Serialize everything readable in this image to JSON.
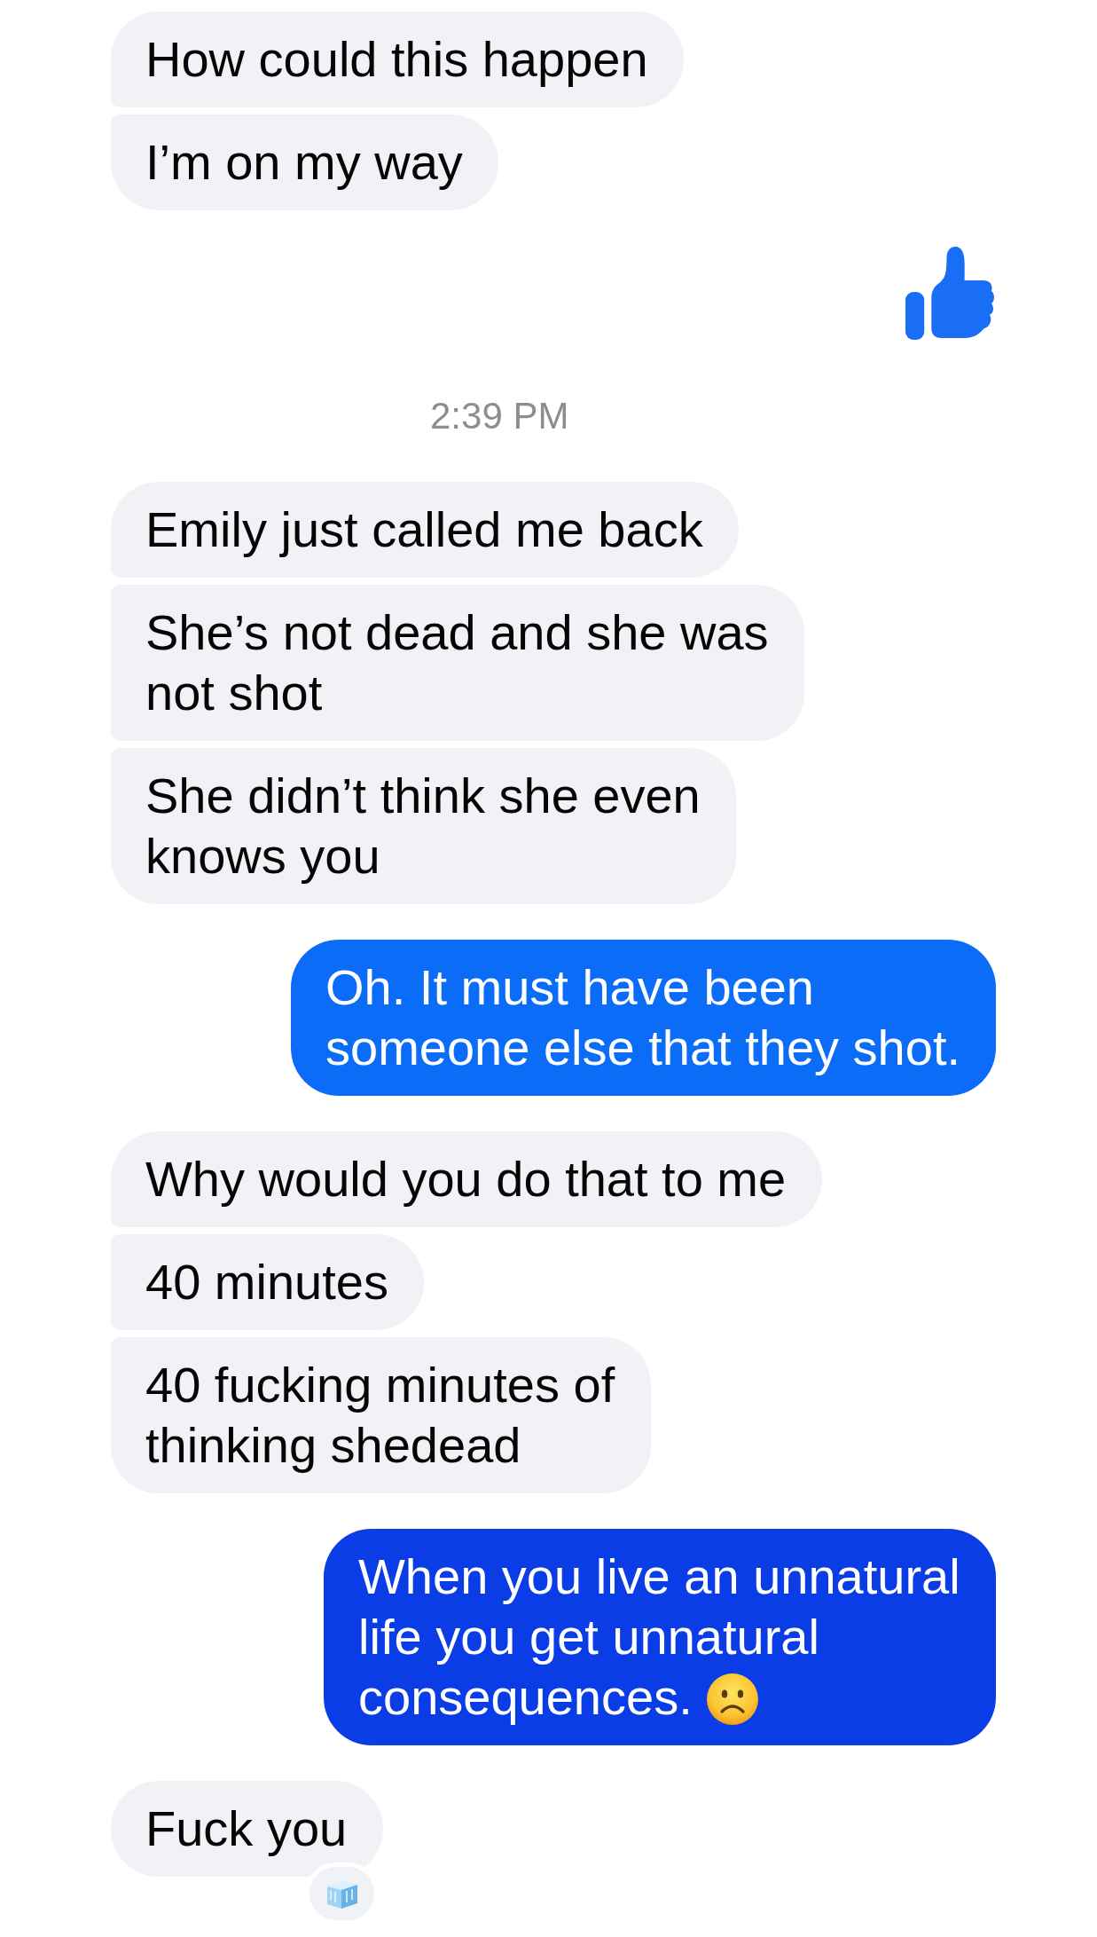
{
  "messages": [
    {
      "kind": "text",
      "outgoing": false,
      "text": "How could this happen"
    },
    {
      "kind": "text",
      "outgoing": false,
      "text": "I’m on my way"
    },
    {
      "kind": "like",
      "outgoing": true,
      "color": "#1a6ef6"
    },
    {
      "kind": "timestamp",
      "text": "2:39 PM"
    },
    {
      "kind": "text",
      "outgoing": false,
      "text": "Emily just called me back"
    },
    {
      "kind": "text",
      "outgoing": false,
      "text": "She’s not dead and she was not shot"
    },
    {
      "kind": "text",
      "outgoing": false,
      "text": "She didn’t think she even knows you"
    },
    {
      "kind": "text",
      "outgoing": true,
      "color": "#0b6cf8",
      "text": "Oh. It must have been someone else that they shot."
    },
    {
      "kind": "text",
      "outgoing": false,
      "text": "Why would you do that to me"
    },
    {
      "kind": "text",
      "outgoing": false,
      "text": "40 minutes"
    },
    {
      "kind": "text",
      "outgoing": false,
      "text": "40 fucking minutes of thinking shedead"
    },
    {
      "kind": "text",
      "outgoing": true,
      "color": "#0a3de6",
      "text": "When you live an unnatural life you get unnatural consequences.",
      "emoji": true
    },
    {
      "kind": "text",
      "outgoing": false,
      "text": "Fuck you",
      "reaction": true
    }
  ]
}
